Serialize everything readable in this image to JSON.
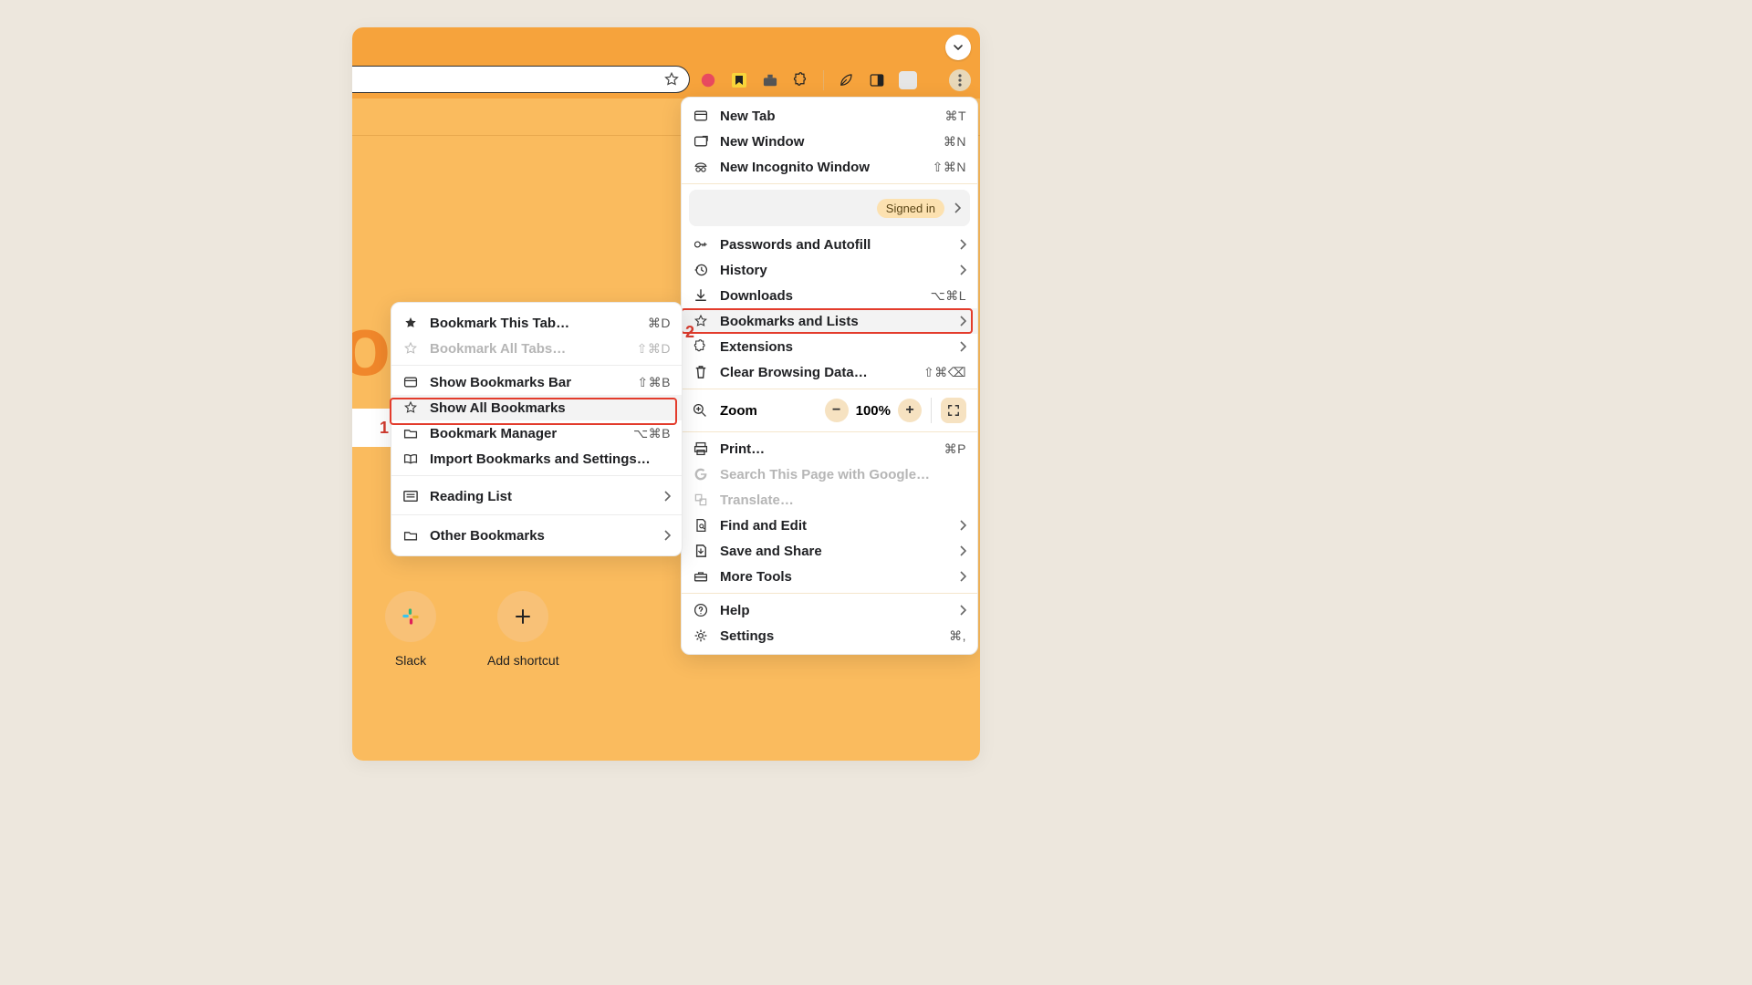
{
  "annotations": {
    "one": "1",
    "two": "2"
  },
  "account": {
    "signed_in": "Signed in"
  },
  "zoom": {
    "label": "Zoom",
    "value": "100%"
  },
  "mainMenu": {
    "new_tab": {
      "label": "New Tab",
      "kbd": "⌘T"
    },
    "new_window": {
      "label": "New Window",
      "kbd": "⌘N"
    },
    "new_incognito": {
      "label": "New Incognito Window",
      "kbd": "⇧⌘N"
    },
    "passwords": {
      "label": "Passwords and Autofill"
    },
    "history": {
      "label": "History"
    },
    "downloads": {
      "label": "Downloads",
      "kbd": "⌥⌘L"
    },
    "bookmarks": {
      "label": "Bookmarks and Lists"
    },
    "extensions": {
      "label": "Extensions"
    },
    "clear_data": {
      "label": "Clear Browsing Data…",
      "kbd": "⇧⌘⌫"
    },
    "print": {
      "label": "Print…",
      "kbd": "⌘P"
    },
    "search_page": {
      "label": "Search This Page with Google…"
    },
    "translate": {
      "label": "Translate…"
    },
    "find_edit": {
      "label": "Find and Edit"
    },
    "save_share": {
      "label": "Save and Share"
    },
    "more_tools": {
      "label": "More Tools"
    },
    "help": {
      "label": "Help"
    },
    "settings": {
      "label": "Settings",
      "kbd": "⌘,"
    }
  },
  "subMenu": {
    "bookmark_tab": {
      "label": "Bookmark This Tab…",
      "kbd": "⌘D"
    },
    "bookmark_all": {
      "label": "Bookmark All Tabs…",
      "kbd": "⇧⌘D"
    },
    "show_bar": {
      "label": "Show Bookmarks Bar",
      "kbd": "⇧⌘B"
    },
    "show_all": {
      "label": "Show All Bookmarks"
    },
    "manager": {
      "label": "Bookmark Manager",
      "kbd": "⌥⌘B"
    },
    "import": {
      "label": "Import Bookmarks and Settings…"
    },
    "reading": {
      "label": "Reading List"
    },
    "other": {
      "label": "Other Bookmarks"
    }
  },
  "shortcuts": {
    "slack": "Slack",
    "add": "Add shortcut"
  },
  "logoFrag": "ogl"
}
